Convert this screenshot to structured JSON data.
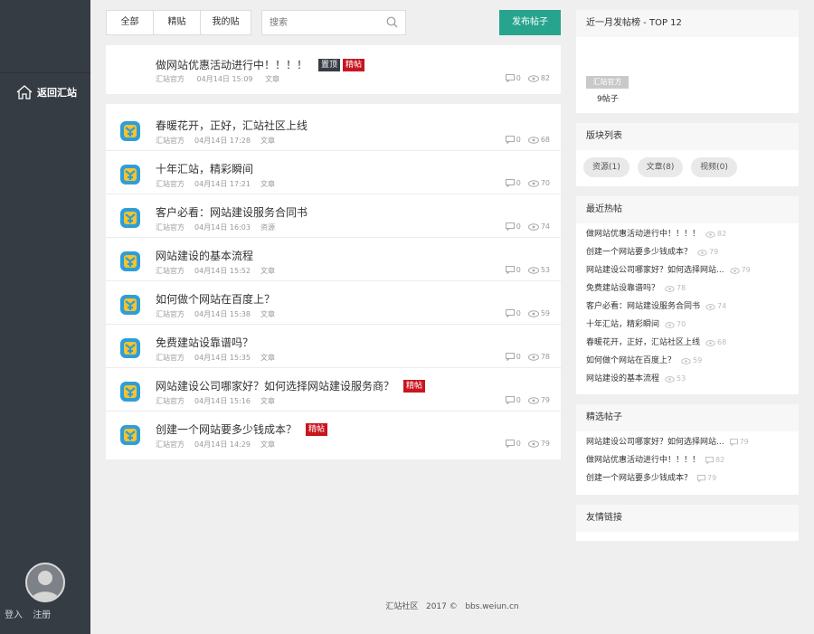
{
  "sidebar": {
    "back_label": "返回汇站",
    "login": "登入",
    "register": "注册"
  },
  "toolbar": {
    "tabs": [
      "全部",
      "精贴",
      "我的贴"
    ],
    "search_placeholder": "搜索",
    "post_button": "发布帖子"
  },
  "pinned": {
    "title": "做网站优惠活动进行中！！！！",
    "badge_top": "置顶",
    "badge_jing": "精帖",
    "author": "汇站官方",
    "date": "04月14日 15:09",
    "category": "文章",
    "comments": "0",
    "views": "82"
  },
  "posts": [
    {
      "title": "春暖花开，正好，汇站社区上线",
      "author": "汇站官方",
      "date": "04月14日 17:28",
      "category": "文章",
      "comments": "0",
      "views": "68",
      "badge": ""
    },
    {
      "title": "十年汇站，精彩瞬间",
      "author": "汇站官方",
      "date": "04月14日 17:21",
      "category": "文章",
      "comments": "0",
      "views": "70",
      "badge": ""
    },
    {
      "title": "客户必看：网站建设服务合同书",
      "author": "汇站官方",
      "date": "04月14日 16:03",
      "category": "资源",
      "comments": "0",
      "views": "74",
      "badge": ""
    },
    {
      "title": "网站建设的基本流程",
      "author": "汇站官方",
      "date": "04月14日 15:52",
      "category": "文章",
      "comments": "0",
      "views": "53",
      "badge": ""
    },
    {
      "title": "如何做个网站在百度上？",
      "author": "汇站官方",
      "date": "04月14日 15:38",
      "category": "文章",
      "comments": "0",
      "views": "59",
      "badge": ""
    },
    {
      "title": "免费建站设靠谱吗？",
      "author": "汇站官方",
      "date": "04月14日 15:35",
      "category": "文章",
      "comments": "0",
      "views": "78",
      "badge": ""
    },
    {
      "title": "网站建设公司哪家好？如何选择网站建设服务商？",
      "author": "汇站官方",
      "date": "04月14日 15:16",
      "category": "文章",
      "comments": "0",
      "views": "79",
      "badge": "精帖"
    },
    {
      "title": "创建一个网站要多少钱成本？",
      "author": "汇站官方",
      "date": "04月14日 14:29",
      "category": "文章",
      "comments": "0",
      "views": "79",
      "badge": "精帖"
    }
  ],
  "top_users": {
    "heading": "近一月发帖榜 - TOP 12",
    "name": "汇站官方",
    "count": "9帖子"
  },
  "boards": {
    "heading": "版块列表",
    "items": [
      "资源(1)",
      "文章(8)",
      "视频(0)"
    ]
  },
  "hot": {
    "heading": "最近热帖",
    "items": [
      {
        "title": "做网站优惠活动进行中！！！！",
        "views": "82"
      },
      {
        "title": "创建一个网站要多少钱成本？",
        "views": "79"
      },
      {
        "title": "网站建设公司哪家好？如何选择网站...",
        "views": "79"
      },
      {
        "title": "免费建站设靠谱吗？",
        "views": "78"
      },
      {
        "title": "客户必看：网站建设服务合同书",
        "views": "74"
      },
      {
        "title": "十年汇站，精彩瞬间",
        "views": "70"
      },
      {
        "title": "春暖花开，正好，汇站社区上线",
        "views": "68"
      },
      {
        "title": "如何做个网站在百度上？",
        "views": "59"
      },
      {
        "title": "网站建设的基本流程",
        "views": "53"
      }
    ]
  },
  "featured": {
    "heading": "精选帖子",
    "items": [
      {
        "title": "网站建设公司哪家好？如何选择网站...",
        "comments": "79"
      },
      {
        "title": "做网站优惠活动进行中！！！！",
        "comments": "82"
      },
      {
        "title": "创建一个网站要多少钱成本？",
        "comments": "79"
      }
    ]
  },
  "links": {
    "heading": "友情链接"
  },
  "footer": {
    "site": "汇站社区",
    "year": "2017 ©",
    "domain": "bbs.weiun.cn"
  },
  "colors": {
    "sidebar": "#363c44",
    "accent": "#27a48d",
    "badge_jing": "#c9151e"
  }
}
